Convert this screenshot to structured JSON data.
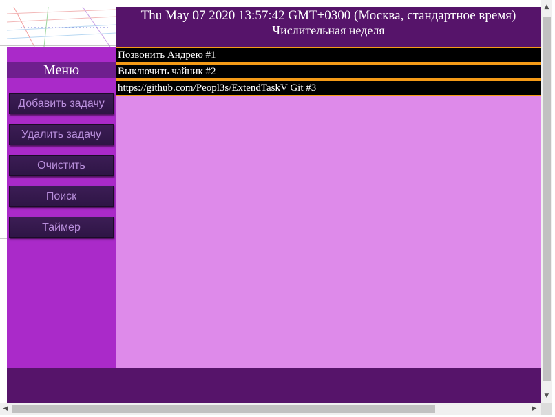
{
  "header": {
    "date": "Thu May 07 2020 13:57:42 GMT+0300 (Москва, стандартное время)",
    "week": "Числительная неделя"
  },
  "sidebar": {
    "title": "Меню",
    "buttons": [
      {
        "label": "Добавить задачу"
      },
      {
        "label": "Удалить задачу"
      },
      {
        "label": "Очистить"
      },
      {
        "label": "Поиск"
      },
      {
        "label": "Таймер"
      }
    ]
  },
  "tasks": [
    {
      "text": "Позвонить Андрею #1"
    },
    {
      "text": "Выключить чайник #2"
    },
    {
      "text": "https://github.com/Peopl3s/ExtendTaskV Git #3"
    }
  ],
  "colors": {
    "header_bg": "#56146a",
    "sidebar_bg": "#aa2ac9",
    "content_bg": "#de8aea",
    "task_border": "#f59b17",
    "button_text": "#b98fdc"
  },
  "icons": {
    "scroll_up": "▲",
    "scroll_down": "▼",
    "scroll_left": "◀",
    "scroll_right": "▶"
  }
}
